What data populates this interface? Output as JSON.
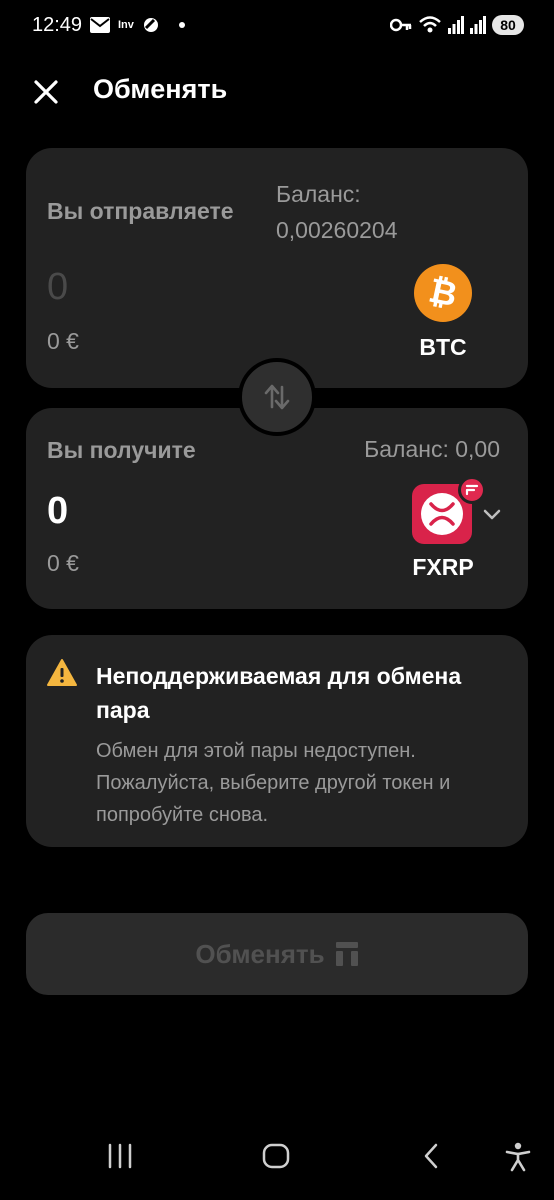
{
  "status_bar": {
    "time": "12:49",
    "left_icons": [
      "mail-icon",
      "inv-icon",
      "app-icon",
      "dot-icon"
    ],
    "inv_label": "Inv",
    "right_icons": [
      "key-icon",
      "wifi-icon",
      "signal-icon",
      "signal-icon"
    ],
    "battery": "80"
  },
  "header": {
    "title": "Обменять",
    "close_icon": "close-icon"
  },
  "send": {
    "label": "Вы отправляете",
    "balance_label": "Баланс:",
    "balance_value": "0,00260204",
    "amount": "0",
    "fiat": "0 €",
    "token_symbol": "BTC",
    "token_color": "#F2901C"
  },
  "swap_icon": "swap-arrows-icon",
  "receive": {
    "label": "Вы получите",
    "balance": "Баланс: 0,00",
    "amount": "0",
    "fiat": "0 €",
    "token_symbol": "FXRP",
    "token_color": "#D9234A"
  },
  "warning": {
    "icon": "warning-icon",
    "title": "Неподдерживаемая для обмена пара",
    "text": "Обмен для этой пары недоступен. Пожалуйста, выберите другой токен и попробуйте снова."
  },
  "exchange_button": {
    "label": "Обменять",
    "icon": "lock-icon"
  },
  "nav_bar": {
    "items": [
      "recents-icon",
      "home-icon",
      "back-icon",
      "accessibility-icon"
    ]
  }
}
